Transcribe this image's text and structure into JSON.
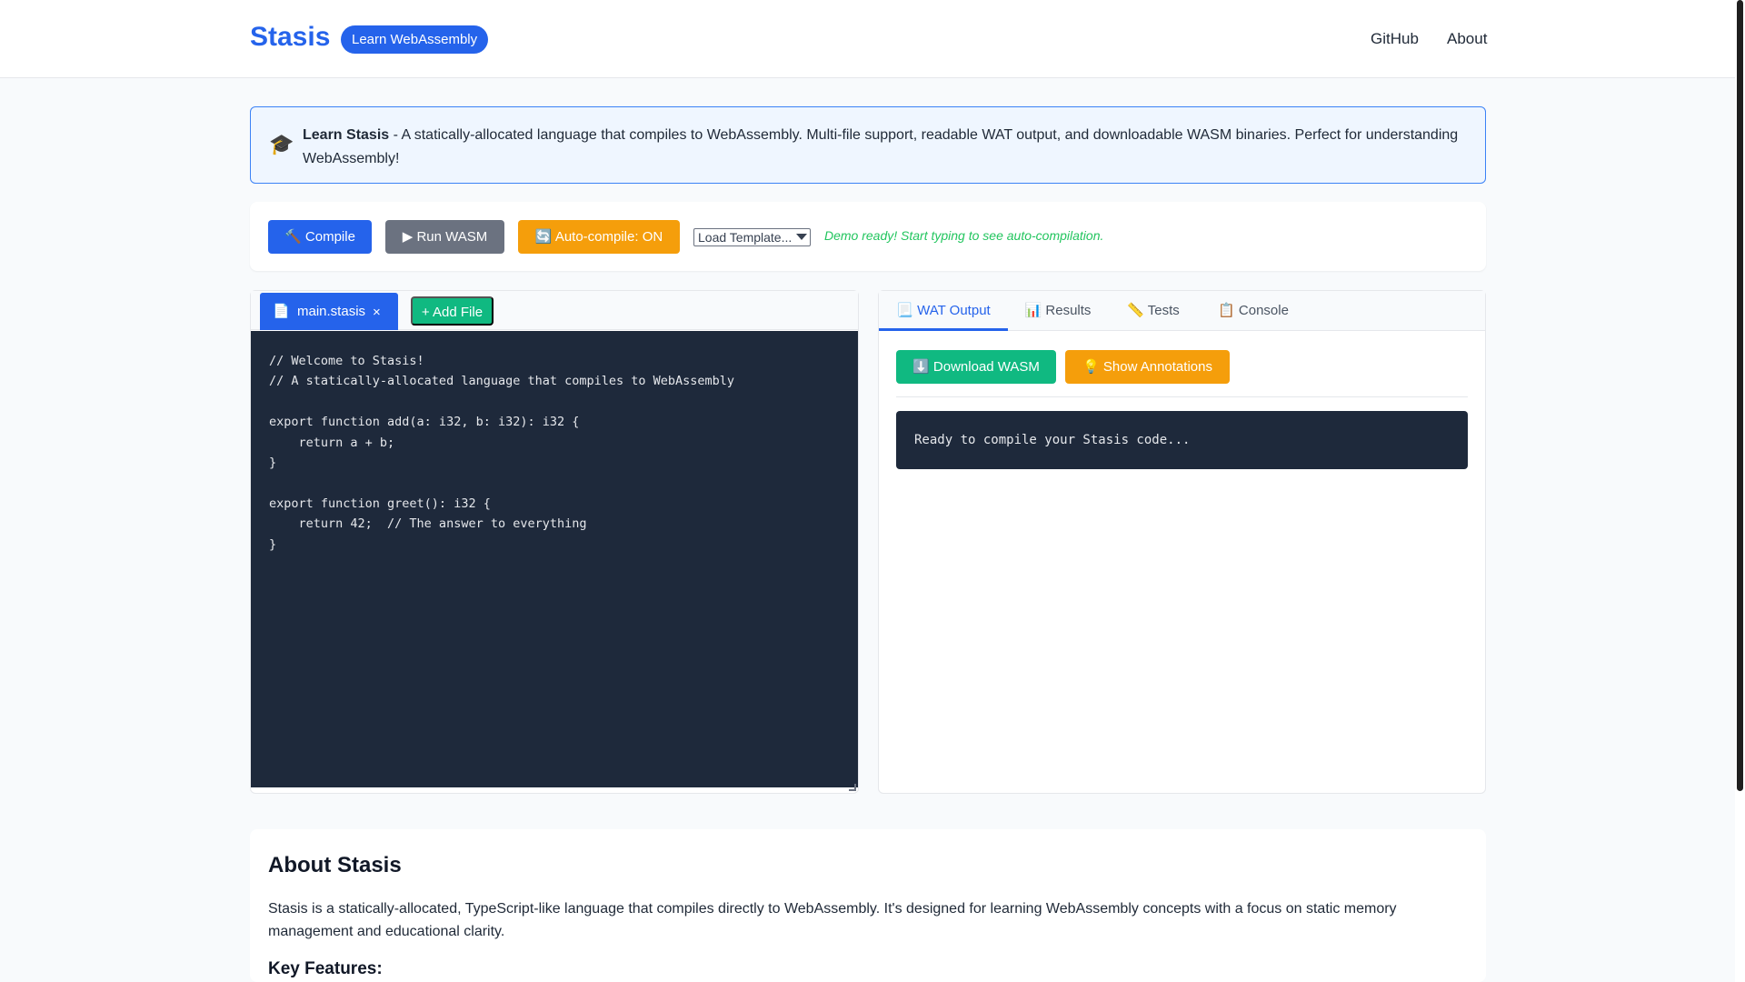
{
  "header": {
    "brand": "Stasis",
    "badge": "Learn WebAssembly",
    "nav": [
      "GitHub",
      "About"
    ]
  },
  "info": {
    "icon": "🎓",
    "title": "Learn Stasis",
    "text": " - A statically-allocated language that compiles to WebAssembly. Multi-file support, readable WAT output, and downloadable WASM binaries. Perfect for understanding WebAssembly!"
  },
  "toolbar": {
    "compile_label": "🔨 Compile",
    "run_label": "▶ Run WASM",
    "autocompile_label": "🔄 Auto-compile: ON",
    "template_select": "Load Template...",
    "status": "Demo ready! Start typing to see auto-compilation."
  },
  "editor": {
    "tabs": [
      {
        "icon": "📄",
        "name": "main.stasis",
        "close": "×"
      }
    ],
    "add_file_label": "+ Add File",
    "code": "// Welcome to Stasis!\n// A statically-allocated language that compiles to WebAssembly\n\nexport function add(a: i32, b: i32): i32 {\n    return a + b;\n}\n\nexport function greet(): i32 {\n    return 42;  // The answer to everything\n}"
  },
  "output": {
    "tabs": [
      {
        "label": "📃 WAT Output",
        "active": true
      },
      {
        "label": "📊 Results",
        "active": false
      },
      {
        "label": "📏 Tests",
        "active": false
      },
      {
        "label": "📋 Console",
        "active": false
      }
    ],
    "download_label": "⬇️ Download WASM",
    "annotations_label": "💡 Show Annotations",
    "console_text": "Ready to compile your Stasis code..."
  },
  "about": {
    "title": "About Stasis",
    "description": "Stasis is a statically-allocated, TypeScript-like language that compiles directly to WebAssembly. It's designed for learning WebAssembly concepts with a focus on static memory management and educational clarity.",
    "features_title": "Key Features:"
  },
  "colors": {
    "accent": "#2563eb",
    "success": "#10b981",
    "warning": "#f59e0b",
    "neutral": "#6b7280",
    "code_bg": "#1e293b"
  }
}
